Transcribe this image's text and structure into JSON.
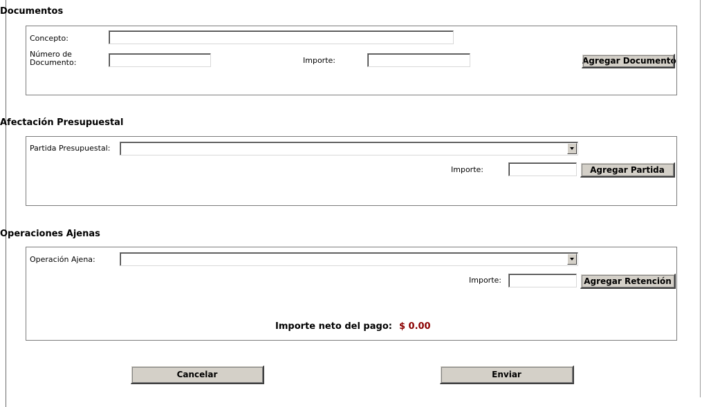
{
  "documentos": {
    "heading": "Documentos",
    "concepto_label": "Concepto:",
    "concepto_value": "",
    "numero_label": "Número de Documento:",
    "numero_value": "",
    "importe_label": "Importe:",
    "importe_value": "",
    "add_button": "Agregar Documento"
  },
  "afectacion": {
    "heading": "Afectación Presupuestal",
    "partida_label": "Partida Presupuestal:",
    "partida_selected": "",
    "importe_label": "Importe:",
    "importe_value": "",
    "add_button": "Agregar Partida"
  },
  "operaciones": {
    "heading": "Operaciones Ajenas",
    "operacion_label": "Operación Ajena:",
    "operacion_selected": "",
    "importe_label": "Importe:",
    "importe_value": "",
    "add_button": "Agregar Retención",
    "net_label": "Importe neto del pago:",
    "net_value": "$ 0.00",
    "net_value_color": "#8b0000"
  },
  "footer": {
    "cancel_button": "Cancelar",
    "send_button": "Enviar"
  }
}
